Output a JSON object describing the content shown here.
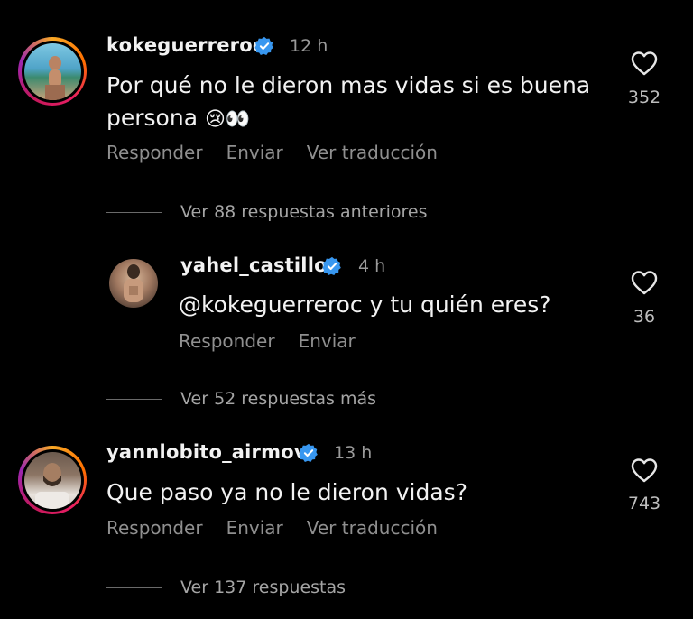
{
  "comments": [
    {
      "username": "kokeguerreroc",
      "time": "12 h",
      "text_line1": "Por qué no le dieron mas vidas si es buena",
      "text_line2": "persona",
      "text_emoji": "😢👀",
      "actions": [
        "Responder",
        "Enviar",
        "Ver traducción"
      ],
      "likes": "352",
      "replies_link": "Ver 88 respuestas anteriores"
    },
    {
      "username": "yahel_castillo",
      "time": "4 h",
      "text": "@kokeguerreroc y tu quién eres?",
      "actions": [
        "Responder",
        "Enviar"
      ],
      "likes": "36",
      "replies_link": "Ver 52 respuestas más"
    },
    {
      "username": "yannlobito_airmov",
      "time": "13 h",
      "text": "Que paso ya no le dieron vidas?",
      "actions": [
        "Responder",
        "Enviar",
        "Ver traducción"
      ],
      "likes": "743",
      "replies_link": "Ver 137 respuestas"
    }
  ],
  "colors": {
    "background": "#000000",
    "verified": "#3897f0",
    "secondary_text": "#8f8f8f"
  }
}
